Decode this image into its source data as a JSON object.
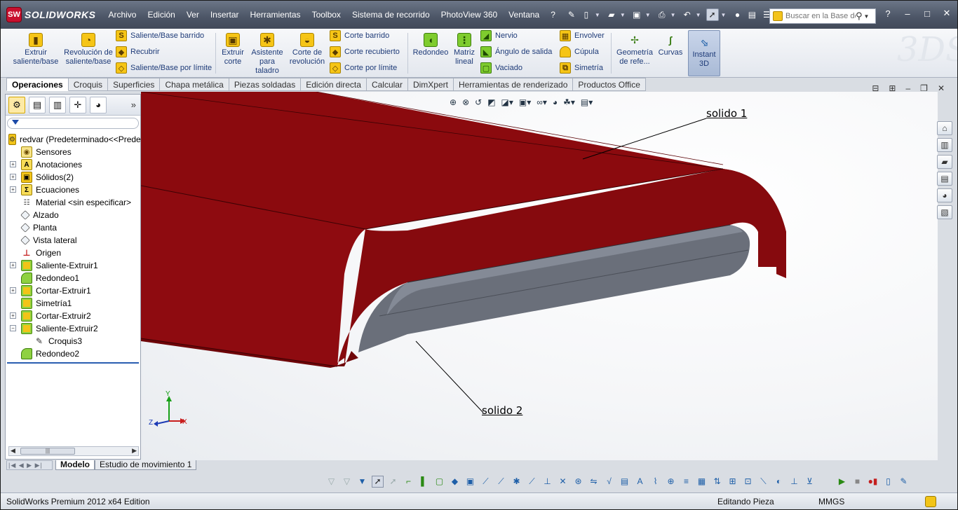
{
  "app": {
    "logo_text": "SOLIDWORKS",
    "logo_badge": "SW"
  },
  "menu": [
    "Archivo",
    "Edición",
    "Ver",
    "Insertar",
    "Herramientas",
    "Toolbox",
    "Sistema de recorrido",
    "PhotoView 360",
    "Ventana",
    "?"
  ],
  "search": {
    "placeholder": "Buscar en la Base de conocimientos"
  },
  "command_manager": {
    "large": [
      {
        "label": "Extruir saliente/base",
        "icon": "extrude-boss-icon"
      },
      {
        "label": "Revolución de saliente/base",
        "icon": "revolve-boss-icon"
      },
      {
        "label": "Extruir corte",
        "icon": "extrude-cut-icon"
      },
      {
        "label": "Asistente para taladro",
        "icon": "hole-wizard-icon"
      },
      {
        "label": "Corte de revolución",
        "icon": "revolve-cut-icon"
      },
      {
        "label": "Redondeo",
        "icon": "fillet-icon"
      },
      {
        "label": "Matriz lineal",
        "icon": "linear-pattern-icon"
      },
      {
        "label": "Geometría de refe...",
        "icon": "reference-geometry-icon"
      },
      {
        "label": "Curvas",
        "icon": "curves-icon"
      },
      {
        "label": "Instant 3D",
        "icon": "instant3d-icon"
      }
    ],
    "small": [
      "Saliente/Base barrido",
      "Recubrir",
      "Saliente/Base por límite",
      "Corte barrido",
      "Corte recubierto",
      "Corte por límite",
      "Nervio",
      "Ángulo de salida",
      "Vaciado",
      "Envolver",
      "Cúpula",
      "Simetría"
    ]
  },
  "tabs": [
    "Operaciones",
    "Croquis",
    "Superficies",
    "Chapa metálica",
    "Piezas soldadas",
    "Edición directa",
    "Calcular",
    "DimXpert",
    "Herramientas de renderizado",
    "Productos Office"
  ],
  "tree": [
    {
      "label": "redvar  (Predeterminado<<Predeterminado>)",
      "icon": "part-icon",
      "expander": ""
    },
    {
      "label": "Sensores",
      "icon": "sensors-icon",
      "expander": ""
    },
    {
      "label": "Anotaciones",
      "icon": "annotations-icon",
      "expander": "+"
    },
    {
      "label": "Sólidos(2)",
      "icon": "solid-bodies-icon",
      "expander": "+"
    },
    {
      "label": "Ecuaciones",
      "icon": "equations-icon",
      "expander": "+"
    },
    {
      "label": "Material <sin especificar>",
      "icon": "material-icon",
      "expander": ""
    },
    {
      "label": "Alzado",
      "icon": "plane-icon",
      "expander": ""
    },
    {
      "label": "Planta",
      "icon": "plane-icon",
      "expander": ""
    },
    {
      "label": "Vista lateral",
      "icon": "plane-icon",
      "expander": ""
    },
    {
      "label": "Origen",
      "icon": "origin-icon",
      "expander": ""
    },
    {
      "label": "Saliente-Extruir1",
      "icon": "extrude-icon",
      "expander": "+"
    },
    {
      "label": "Redondeo1",
      "icon": "fillet-icon",
      "expander": ""
    },
    {
      "label": "Cortar-Extruir1",
      "icon": "cut-extrude-icon",
      "expander": "+"
    },
    {
      "label": "Simetría1",
      "icon": "mirror-icon",
      "expander": ""
    },
    {
      "label": "Cortar-Extruir2",
      "icon": "cut-extrude-icon",
      "expander": "+"
    },
    {
      "label": "Saliente-Extruir2",
      "icon": "extrude-icon",
      "expander": "−"
    },
    {
      "label": "Croquis3",
      "icon": "sketch-icon",
      "expander": "",
      "indent": 1
    },
    {
      "label": "Redondeo2",
      "icon": "fillet-icon",
      "expander": ""
    }
  ],
  "viewport": {
    "callouts": [
      "solido 1",
      "solido 2"
    ],
    "triad": {
      "x": "X",
      "y": "Y",
      "z": "Z"
    },
    "colors": {
      "body": "#8b0a0e",
      "body_dark": "#6e0508",
      "cylinder": "#6a6f7a"
    }
  },
  "bottom_tabs": [
    "Modelo",
    "Estudio de movimiento 1"
  ],
  "status": {
    "edition": "SolidWorks Premium 2012 x64 Edition",
    "mode": "Editando Pieza",
    "units": "MMGS"
  }
}
